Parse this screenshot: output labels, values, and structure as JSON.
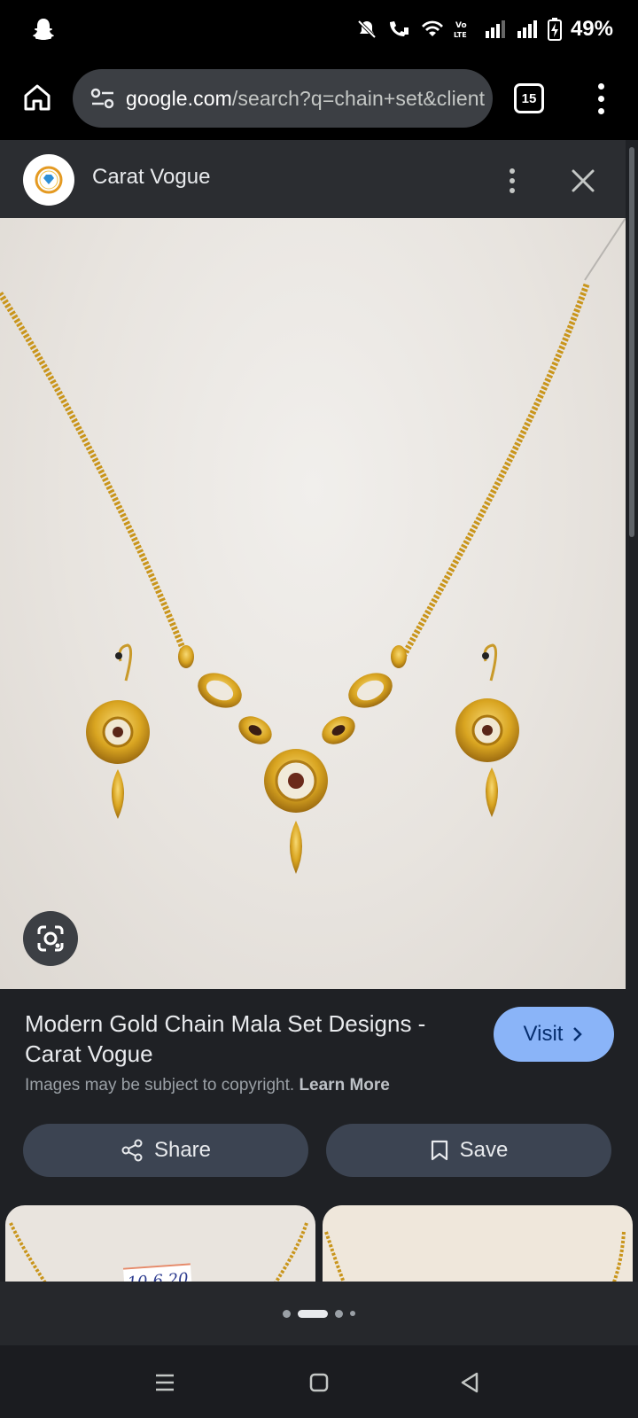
{
  "status_bar": {
    "battery": "49%",
    "icons": [
      "snapchat-icon",
      "mute-icon",
      "wifi-calling-icon",
      "wifi-icon",
      "volte-icon",
      "signal-icon",
      "signal-icon",
      "battery-charging-icon"
    ]
  },
  "browser": {
    "url_host": "google.com",
    "url_path": "/search?q=chain+set&client",
    "tab_count": "15"
  },
  "viewer": {
    "site_name": "Carat Vogue",
    "title": "Modern Gold Chain Mala Set Designs - Carat Vogue",
    "visit_label": "Visit",
    "copyright_text": "Images may be subject to copyright.",
    "learn_more": "Learn More",
    "share_label": "Share",
    "save_label": "Save"
  },
  "related": {
    "thumb1_label": "10-6.20"
  },
  "colors": {
    "accent": "#8ab4f8",
    "background": "#1f2125",
    "chip": "#3c4452",
    "gold": "#d9a521"
  }
}
